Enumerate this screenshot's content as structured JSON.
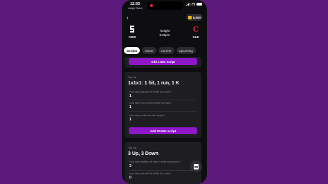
{
  "status": {
    "time": "12:53",
    "back_app": "◂ App Store"
  },
  "header": {
    "back": "‹",
    "coins": "5,000"
  },
  "matchup": {
    "away": {
      "abbr": "CWS",
      "logo": "Sox"
    },
    "home": {
      "abbr": "CLE",
      "logo": "C"
    },
    "time_label": "Tonight",
    "time": "6:05pm"
  },
  "tabs": [
    {
      "label": "Scripts"
    },
    {
      "label": "Game"
    },
    {
      "label": "Current"
    },
    {
      "label": "Upcoming"
    }
  ],
  "cards": [
    {
      "cta": "Add 1.69x script"
    },
    {
      "tag": "Top 1st",
      "title": "1x1x1: 1 hit, 1 run, 1 K",
      "questions": [
        {
          "q": "How many hits will the White Sox have?",
          "a": "1"
        },
        {
          "q": "How many runs will the White Sox have?",
          "a": "1"
        },
        {
          "q": "How many strikeouts will happen?",
          "a": "1"
        }
      ],
      "cta": "Add 20.00x script"
    },
    {
      "tag": "Top 1st",
      "title": "3 Up, 3 Down",
      "questions": [
        {
          "q": "How many batters will make a plate appearance?",
          "a": "3"
        },
        {
          "q": "How many hits will the White Sox have?",
          "a": "0"
        }
      ]
    }
  ],
  "colors": {
    "accent": "#8e17c8",
    "background": "#5b1a7a",
    "coin": "#e9b820"
  }
}
